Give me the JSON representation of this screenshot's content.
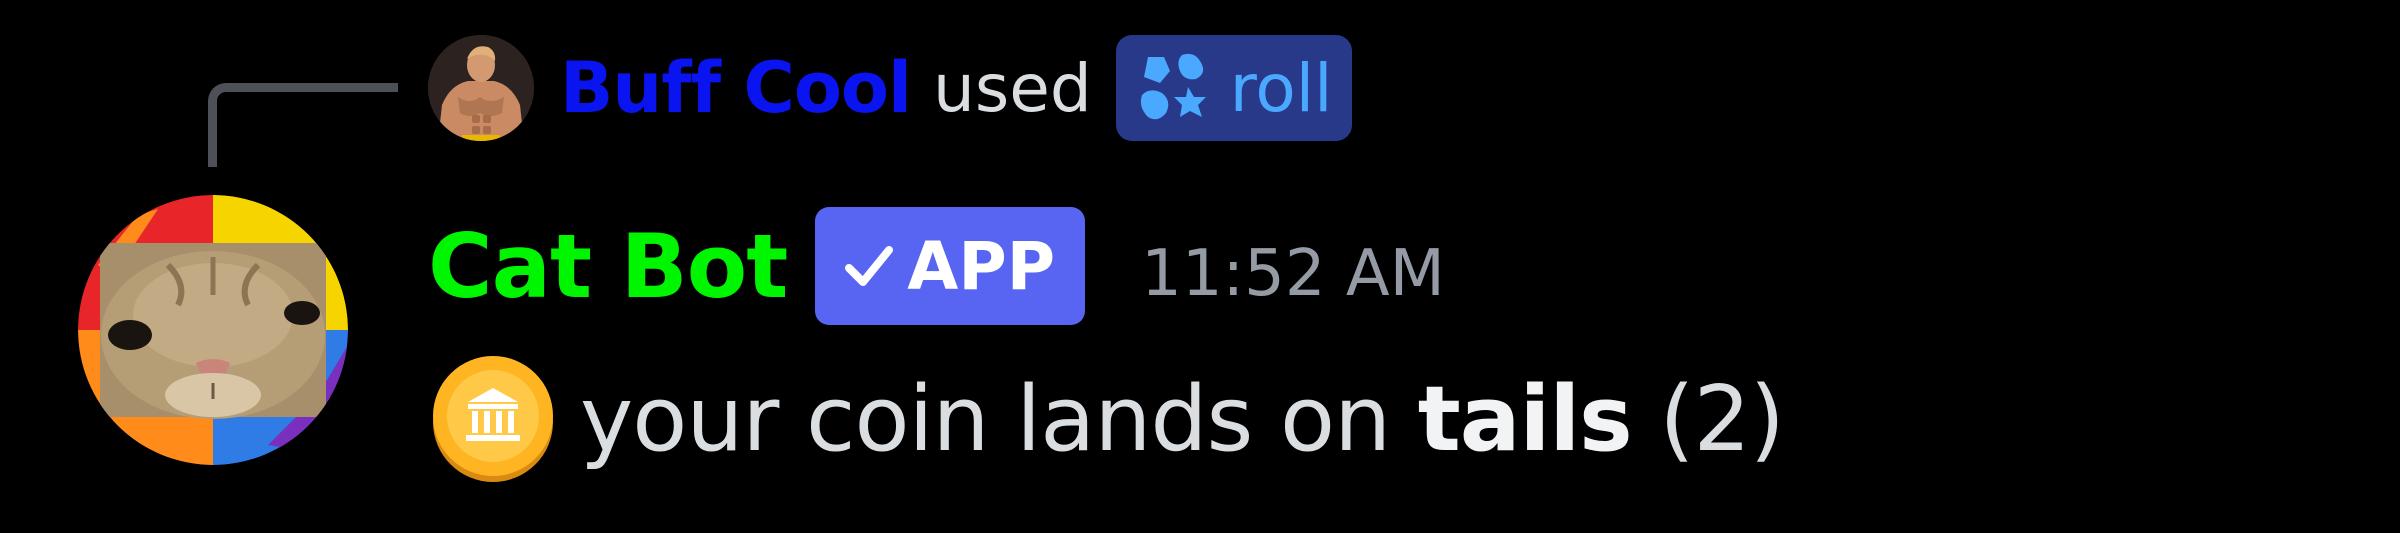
{
  "reply": {
    "user_name": "Buff Cool",
    "used_text": "used",
    "command": "roll",
    "user_color": "#0a14f0"
  },
  "message": {
    "author": "Cat Bot",
    "author_color": "#00f500",
    "app_tag": "APP",
    "timestamp": "11:52 AM",
    "content_before": "your coin lands on",
    "content_bold": "tails",
    "content_after": "(2)"
  },
  "icons": {
    "reply_avatar": "muscular-man-avatar",
    "command_icon": "app-command-icon",
    "bot_avatar": "cat-face-avatar",
    "app_check": "checkmark-icon",
    "coin": "coin-emoji-icon"
  },
  "colors": {
    "background": "#000000",
    "app_tag": "#5865f2",
    "command_pill": "#28398a",
    "command_text": "#4aa8ff",
    "timestamp": "#949ba4",
    "text": "#dbdee1"
  }
}
